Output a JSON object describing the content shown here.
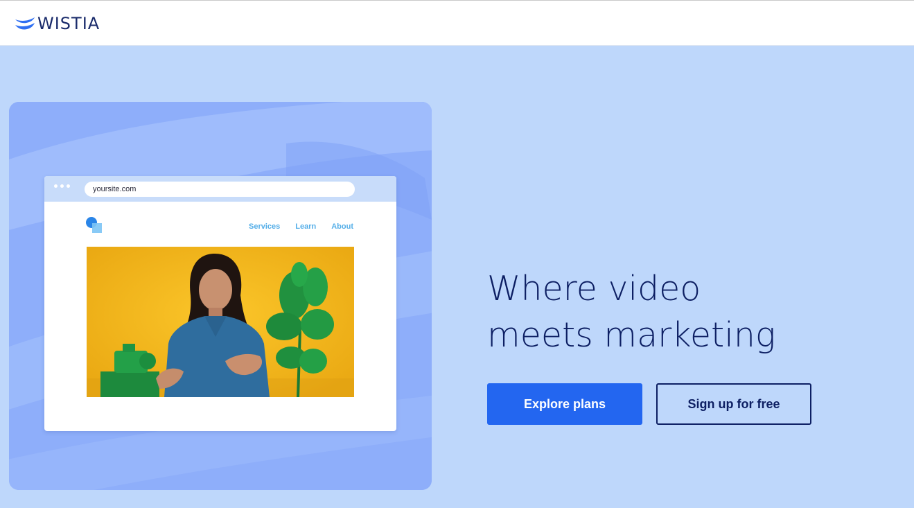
{
  "header": {
    "logo_text": "WISTIA"
  },
  "hero": {
    "headline_line1": "Where video",
    "headline_line2": "meets marketing",
    "primary_button_label": "Explore plans",
    "secondary_button_label": "Sign up for free"
  },
  "mock_browser": {
    "url": "yoursite.com",
    "nav_items": [
      "Services",
      "Learn",
      "About"
    ]
  },
  "colors": {
    "hero_background": "#bed7fb",
    "card_background": "#8fb0fa",
    "headline": "#0d1f63",
    "primary_button": "#2366f0",
    "nav_link": "#54aee8",
    "video_background": "#f6bd1e"
  },
  "icons": {
    "logo": "wistia-logo-icon",
    "site_logo": "site-logo-icon",
    "browser_dots": "window-dots-icon"
  }
}
